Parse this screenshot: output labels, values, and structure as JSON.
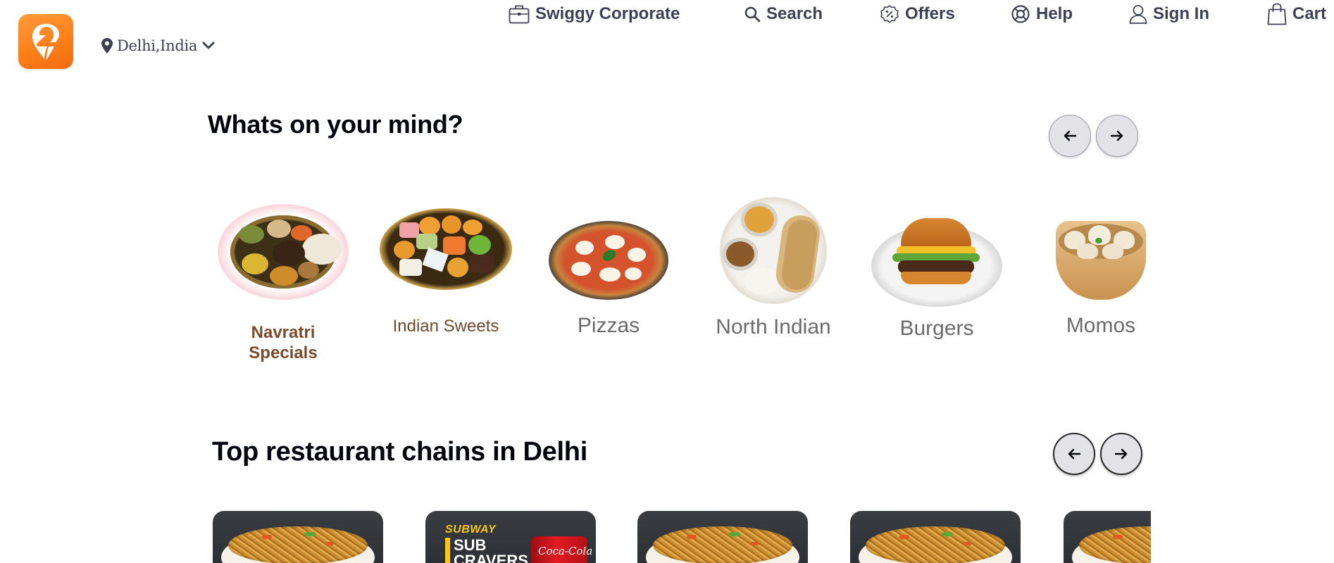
{
  "header": {
    "location": "Delhi,India",
    "nav": [
      {
        "key": "corporate",
        "label": "Swiggy Corporate",
        "icon": "briefcase-icon"
      },
      {
        "key": "search",
        "label": "Search",
        "icon": "search-icon"
      },
      {
        "key": "offers",
        "label": "Offers",
        "icon": "offers-percent-icon"
      },
      {
        "key": "help",
        "label": "Help",
        "icon": "help-lifebuoy-icon"
      },
      {
        "key": "signin",
        "label": "Sign In",
        "icon": "user-icon"
      },
      {
        "key": "cart",
        "label": "Cart",
        "icon": "shopping-bag-icon"
      }
    ]
  },
  "mind_section": {
    "title": "Whats on your mind?",
    "cuisines": [
      {
        "label": "Navratri\nSpecials",
        "label_color": "#7a4a2a"
      },
      {
        "label": "Indian Sweets",
        "label_color": "#6e4a2d"
      },
      {
        "label": "Pizzas",
        "label_color": "#6a6a6a"
      },
      {
        "label": "North Indian",
        "label_color": "#6a6a6a"
      },
      {
        "label": "Burgers",
        "label_color": "#6a6a6a"
      },
      {
        "label": "Momos",
        "label_color": "#6a6a6a"
      }
    ]
  },
  "chains_section": {
    "title": "Top restaurant chains in Delhi",
    "cards": [
      {
        "type": "noodles"
      },
      {
        "type": "subway",
        "brand": "SUBWAY",
        "promo": "SUB CRAVERS",
        "drink": "Coca-Cola"
      },
      {
        "type": "noodles"
      },
      {
        "type": "noodles"
      },
      {
        "type": "noodles"
      }
    ]
  },
  "colors": {
    "brand": "#fc8019",
    "nav_text": "#3d4152",
    "heading": "#02060c",
    "arrow_bg": "#e2e2e7"
  }
}
